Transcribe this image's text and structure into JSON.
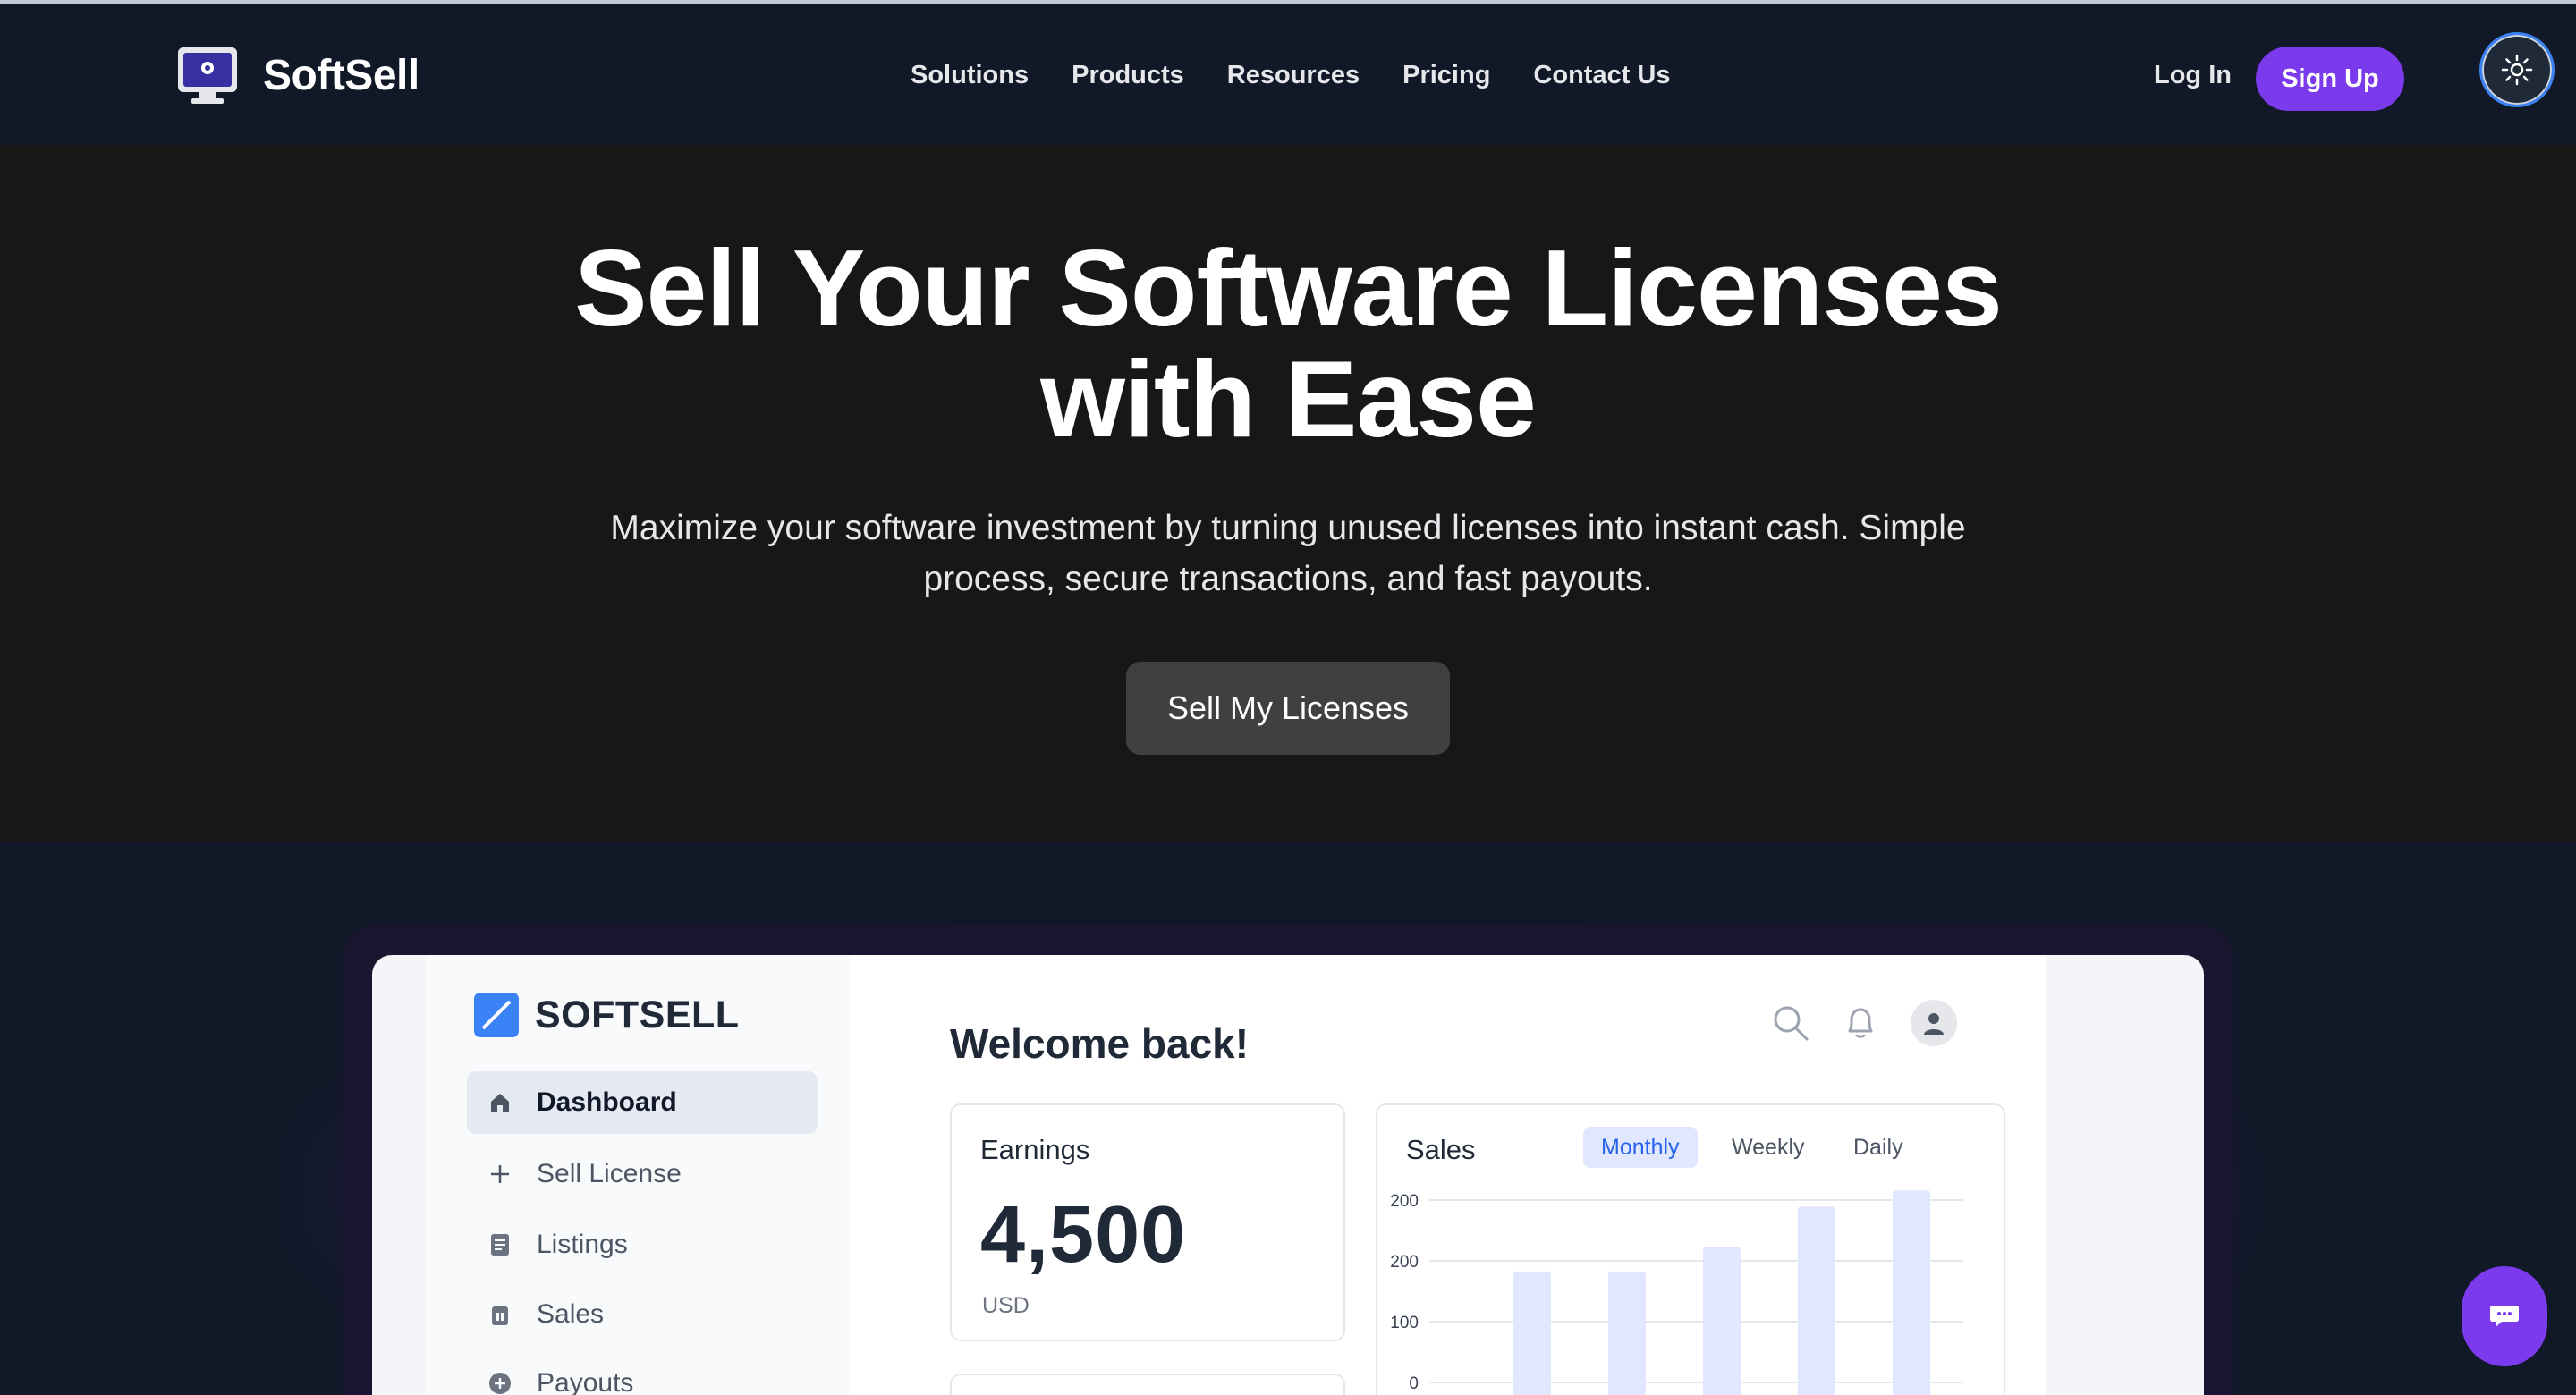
{
  "nav": {
    "brand": "SoftSell",
    "links": [
      "Solutions",
      "Products",
      "Resources",
      "Pricing",
      "Contact Us"
    ],
    "login": "Log In",
    "signup": "Sign Up",
    "theme_icon": "sun-icon"
  },
  "hero": {
    "title_line1": "Sell Your Software Licenses",
    "title_line2": "with Ease",
    "subtitle_line1": "Maximize your software investment by turning unused licenses into instant cash. Simple",
    "subtitle_line2": "process, secure transactions, and fast payouts.",
    "cta": "Sell My Licenses"
  },
  "dashboard": {
    "logo": "SOFTSELL",
    "sidebar": [
      {
        "label": "Dashboard",
        "icon": "home-icon",
        "active": true
      },
      {
        "label": "Sell License",
        "icon": "plus-icon",
        "active": false
      },
      {
        "label": "Listings",
        "icon": "document-icon",
        "active": false
      },
      {
        "label": "Sales",
        "icon": "trash-icon",
        "active": false
      },
      {
        "label": "Payouts",
        "icon": "plus-circle-icon",
        "active": false
      }
    ],
    "welcome": "Welcome back!",
    "top_icons": [
      "search-icon",
      "bell-icon",
      "user-icon"
    ],
    "earnings": {
      "title": "Earnings",
      "value": "4,500",
      "unit": "USD"
    },
    "sales": {
      "title": "Sales",
      "tabs": [
        "Monthly",
        "Weekly",
        "Daily"
      ],
      "active_tab": "Monthly"
    }
  },
  "colors": {
    "accent": "#7c3aed",
    "nav_bg": "#111827",
    "hero_bg": "#171717",
    "bar": "#e0e7ff"
  },
  "chart_data": {
    "type": "bar",
    "title": "Sales",
    "y_ticks": [
      "200",
      "200",
      "100",
      "0"
    ],
    "values": [
      170,
      170,
      200,
      250,
      270
    ],
    "ylim": [
      0,
      300
    ],
    "grid": true
  },
  "chat_icon": "chat-bubble-icon"
}
